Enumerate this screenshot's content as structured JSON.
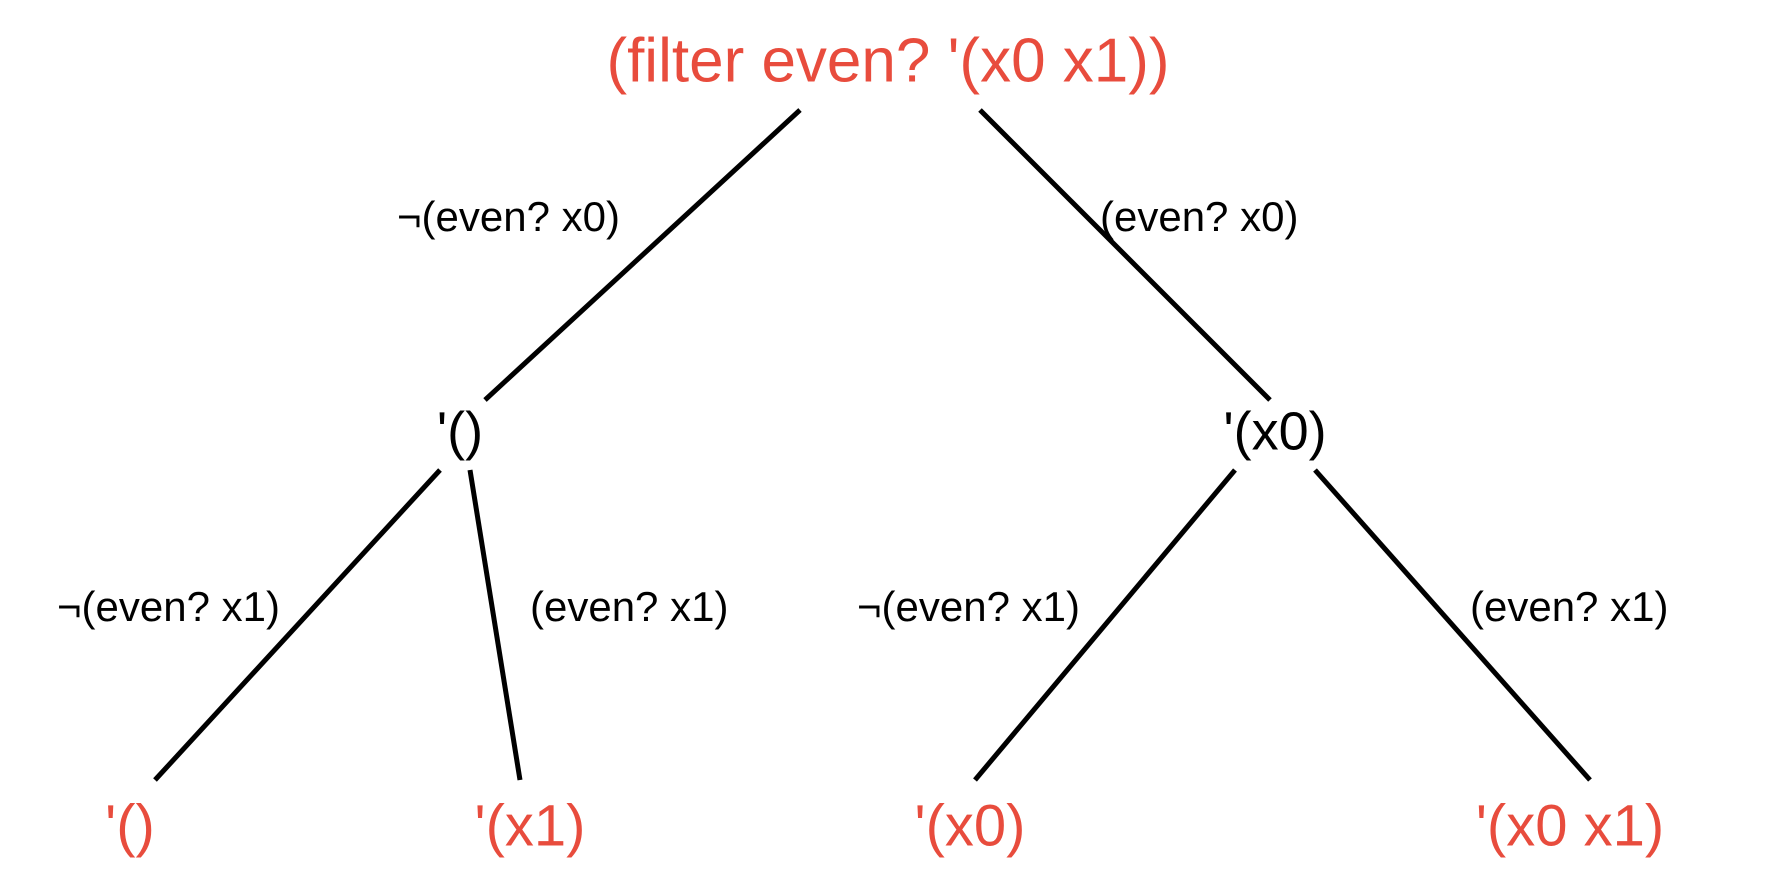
{
  "tree": {
    "root": {
      "label": "(filter even? '(x0 x1))",
      "edges": {
        "left": "¬(even? x0)",
        "right": "(even? x0)"
      }
    },
    "mid": {
      "left": {
        "label": "'()",
        "edges": {
          "left": "¬(even? x1)",
          "right": "(even? x1)"
        }
      },
      "right": {
        "label": "'(x0)",
        "edges": {
          "left": "¬(even? x1)",
          "right": "(even? x1)"
        }
      }
    },
    "leaves": {
      "l0": "'()",
      "l1": "'(x1)",
      "l2": "'(x0)",
      "l3": "'(x0 x1)"
    }
  },
  "colors": {
    "highlight": "#e84c3d",
    "text": "#000000",
    "line": "#000000"
  }
}
